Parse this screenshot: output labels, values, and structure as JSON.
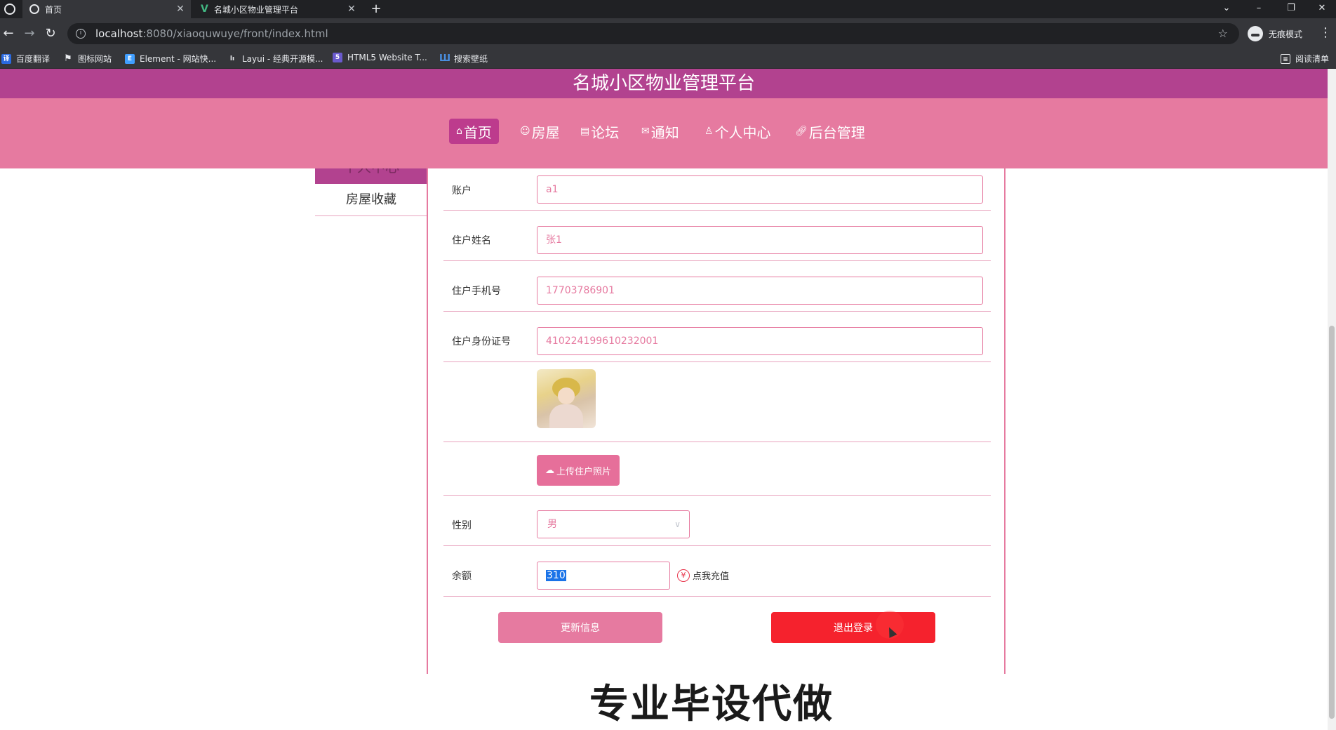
{
  "browser": {
    "tabs": [
      {
        "title": "首页",
        "active": true,
        "icon": "globe-icon"
      },
      {
        "title": "名城小区物业管理平台",
        "active": false,
        "icon": "vue-icon"
      }
    ],
    "url_host": "localhost",
    "url_path": ":8080/xiaoquwuye/front/index.html",
    "incognito_label": "无痕模式",
    "bookmarks": [
      {
        "label": "百度翻译",
        "icon": "translate-icon",
        "color": "#2a6ae0"
      },
      {
        "label": "图标网站",
        "icon": "flag-icon",
        "color": "#e8eaed"
      },
      {
        "label": "Element - 网站快...",
        "icon": "element-icon",
        "color": "#409eff"
      },
      {
        "label": "Layui - 经典开源模...",
        "icon": "layui-icon",
        "color": "#5fb878"
      },
      {
        "label": "HTML5 Website T...",
        "icon": "html5-icon",
        "color": "#6a5acd"
      },
      {
        "label": "搜索壁纸",
        "icon": "wallpaper-icon",
        "color": "#4a90e2"
      }
    ],
    "reading_list": "阅读清单"
  },
  "site": {
    "title": "名城小区物业管理平台",
    "nav": [
      {
        "label": "首页",
        "icon": "home-icon",
        "active": true
      },
      {
        "label": "房屋",
        "icon": "house-icon",
        "active": false
      },
      {
        "label": "论坛",
        "icon": "forum-icon",
        "active": false
      },
      {
        "label": "通知",
        "icon": "mail-icon",
        "active": false
      },
      {
        "label": "个人中心",
        "icon": "user-icon",
        "active": false
      },
      {
        "label": "后台管理",
        "icon": "link-icon",
        "active": false
      }
    ]
  },
  "sidebar": {
    "active_label": "个人中心",
    "items": [
      {
        "label": "房屋收藏"
      }
    ]
  },
  "form": {
    "account_label": "账户",
    "account_value": "a1",
    "name_label": "住户姓名",
    "name_value": "张1",
    "phone_label": "住户手机号",
    "phone_value": "17703786901",
    "id_label": "住户身份证号",
    "id_value": "410224199610232001",
    "upload_label": "上传住户照片",
    "gender_label": "性别",
    "gender_value": "男",
    "balance_label": "余额",
    "balance_value": "310",
    "recharge_label": "点我充值",
    "update_button": "更新信息",
    "logout_button": "退出登录"
  },
  "watermark": "专业毕设代做",
  "colors": {
    "header": "#b2428f",
    "nav": "#e67aa0",
    "active_nav": "#bd3b8d",
    "logout": "#f5222d"
  }
}
